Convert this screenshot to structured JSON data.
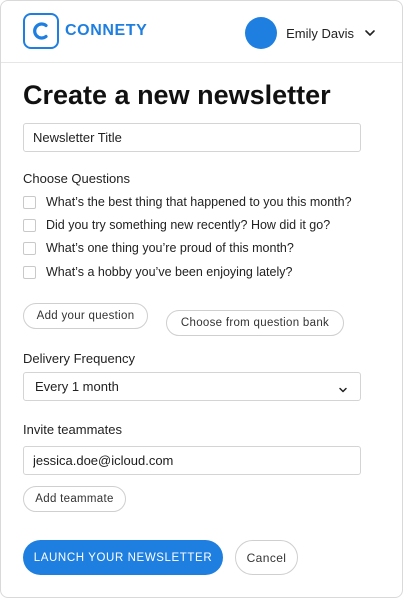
{
  "header": {
    "brand": "CONNETY",
    "user_name": "Emily Davis",
    "accent_color": "#1f7fe0"
  },
  "main": {
    "title": "Create a new newsletter",
    "title_input": {
      "placeholder": "Newsletter Title",
      "value": ""
    },
    "questions_label": "Choose Questions",
    "questions": [
      {
        "text": "What’s the best thing that happened to you this month?",
        "checked": false
      },
      {
        "text": "Did you try something new recently? How did it go?",
        "checked": false
      },
      {
        "text": "What’s one thing you’re proud of this month?",
        "checked": false
      },
      {
        "text": "What’s a hobby you’ve been enjoying lately?",
        "checked": false
      }
    ],
    "add_question_label": "Add your question",
    "question_bank_label": "Choose from question bank",
    "frequency_label": "Delivery Frequency",
    "frequency_value": "Every 1 month",
    "invite_label": "Invite teammates",
    "invite_input": {
      "value": "jessica.doe@icloud.com",
      "placeholder": ""
    },
    "add_teammate_label": "Add teammate",
    "launch_label": "LAUNCH YOUR NEWSLETTER",
    "cancel_label": "Cancel"
  },
  "icons": {
    "logo": "c-logo-icon",
    "user_menu": "chevron-down-icon",
    "select": "chevron-down-icon"
  }
}
